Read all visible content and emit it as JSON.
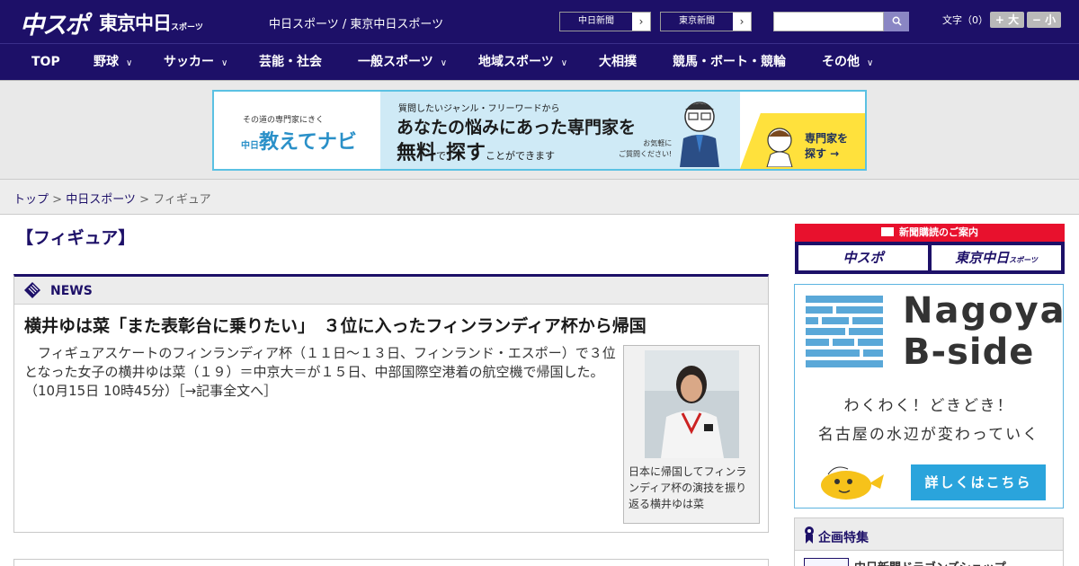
{
  "header": {
    "logo_chunichi": "中スポ",
    "logo_tokyo": "東京中日",
    "logo_tokyo_small": "スポーツ",
    "site_names": "中日スポーツ / 東京中日スポーツ",
    "paper_buttons": [
      {
        "label": "中日新聞"
      },
      {
        "label": "東京新聞"
      }
    ],
    "search_placeholder": "",
    "font_size_label": "文字（0）",
    "font_plus": "+ 大",
    "font_minus": "− 小"
  },
  "nav": {
    "items": [
      {
        "label": "TOP",
        "has_menu": false
      },
      {
        "label": "野球",
        "has_menu": true
      },
      {
        "label": "サッカー",
        "has_menu": true
      },
      {
        "label": "芸能・社会",
        "has_menu": false
      },
      {
        "label": "一般スポーツ",
        "has_menu": true
      },
      {
        "label": "地域スポーツ",
        "has_menu": true
      },
      {
        "label": "大相撲",
        "has_menu": false
      },
      {
        "label": "競馬・ボート・競輪",
        "has_menu": false
      },
      {
        "label": "その他",
        "has_menu": true
      }
    ]
  },
  "banner": {
    "sub": "その道の専門家にきく",
    "brand": "教えてナビ",
    "brand_prefix": "中日",
    "line1": "質問したいジャンル・フリーワードから",
    "line2": "あなたの悩みにあった専門家を",
    "line3a": "無料",
    "line3b": "で",
    "line3c": "探す",
    "line3d": "ことができます",
    "note1": "お気軽に",
    "note2": "ご質問ください!",
    "cta1": "専門家を",
    "cta2": "探す →"
  },
  "breadcrumb": {
    "top": "トップ",
    "sep": " > ",
    "section": "中日スポーツ",
    "current": "フィギュア"
  },
  "page": {
    "title": "【フィギュア】"
  },
  "news": {
    "label": "NEWS",
    "headline": "横井ゆは菜「また表彰台に乗りたい」　３位に入ったフィンランディア杯から帰国",
    "body": "　フィギュアスケートのフィンランディア杯（１１日～１３日、フィンランド・エスポー）で３位となった女子の横井ゆは菜（１９）＝中京大＝が１５日、中部国際空港着の航空機で帰国した。（10月15日 10時45分）［→記事全文へ］",
    "caption": "日本に帰国してフィンランディア杯の演技を振り返る横井ゆは菜"
  },
  "sidebar": {
    "subscription": {
      "title": "新聞購読のご案内",
      "left": "中スポ",
      "right": "東京中日",
      "right_small": "スポーツ"
    },
    "bside": {
      "title1": "Nagoya",
      "title2": "B-side",
      "line1": "わくわく！どきどき！",
      "line2": "名古屋の水辺が変わっていく",
      "cta": "詳しくはこちら"
    },
    "feature": {
      "title": "企画特集",
      "item": "中日新聞ドラゴンズショップ"
    }
  },
  "colors": {
    "navy": "#1d1068",
    "red": "#e8112d",
    "sky": "#2aa4dc",
    "yellow": "#ffe13c"
  }
}
